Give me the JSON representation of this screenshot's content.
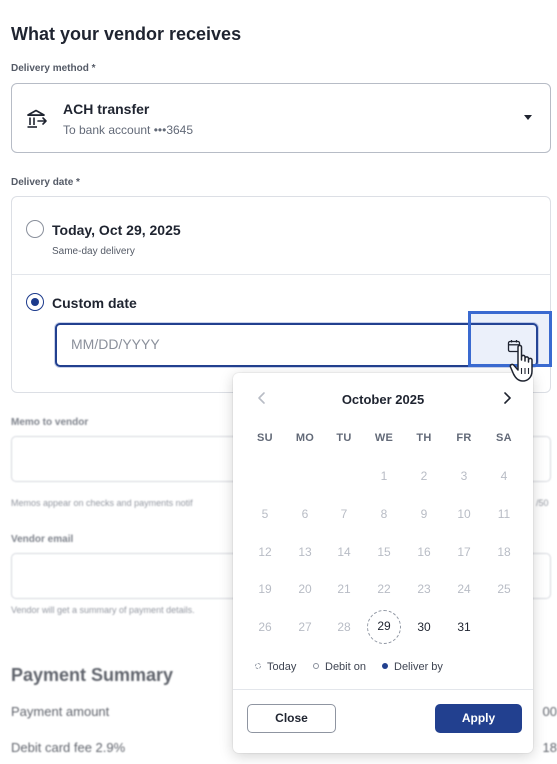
{
  "section_title": "What your vendor receives",
  "delivery_method": {
    "label": "Delivery method *",
    "icon": "bank-transfer-icon",
    "title": "ACH transfer",
    "subtitle": "To bank account •••3645"
  },
  "delivery_date": {
    "label": "Delivery date *",
    "option_today": {
      "title": "Today, Oct 29, 2025",
      "subtitle": "Same-day delivery",
      "selected": false
    },
    "option_custom": {
      "title": "Custom date",
      "selected": true
    },
    "input_placeholder": "MM/DD/YYYY",
    "input_value": ""
  },
  "background": {
    "memo_label": "Memo to vendor",
    "memo_hint": "Memos appear on checks and payments notif",
    "memo_counter": "/50",
    "email_label": "Vendor email",
    "email_hint": "Vendor will get a summary of payment details.",
    "summary_title": "Payment Summary",
    "rows": [
      {
        "label": "Payment amount",
        "value": "00"
      },
      {
        "label": "Debit card fee 2.9%",
        "value": "18"
      }
    ]
  },
  "calendar": {
    "month_label": "October 2025",
    "weekdays": [
      "SU",
      "MO",
      "TU",
      "WE",
      "TH",
      "FR",
      "SA"
    ],
    "weeks": [
      [
        "",
        "",
        "",
        "1",
        "2",
        "3",
        "4"
      ],
      [
        "5",
        "6",
        "7",
        "8",
        "9",
        "10",
        "11"
      ],
      [
        "12",
        "13",
        "14",
        "15",
        "16",
        "17",
        "18"
      ],
      [
        "19",
        "20",
        "21",
        "22",
        "23",
        "24",
        "25"
      ],
      [
        "26",
        "27",
        "28",
        "29",
        "30",
        "31",
        ""
      ]
    ],
    "today": "29",
    "enabled_days": [
      "29",
      "30",
      "31"
    ],
    "legend": [
      {
        "label": "Today",
        "style": "dashed-circle",
        "color": "#9097a3"
      },
      {
        "label": "Debit on",
        "style": "hollow-circle",
        "color": "#8a909c"
      },
      {
        "label": "Deliver by",
        "style": "filled-dot",
        "color": "#22408f"
      }
    ],
    "close_label": "Close",
    "apply_label": "Apply"
  },
  "colors": {
    "accent": "#22408f",
    "highlight": "#3a6ad0"
  }
}
